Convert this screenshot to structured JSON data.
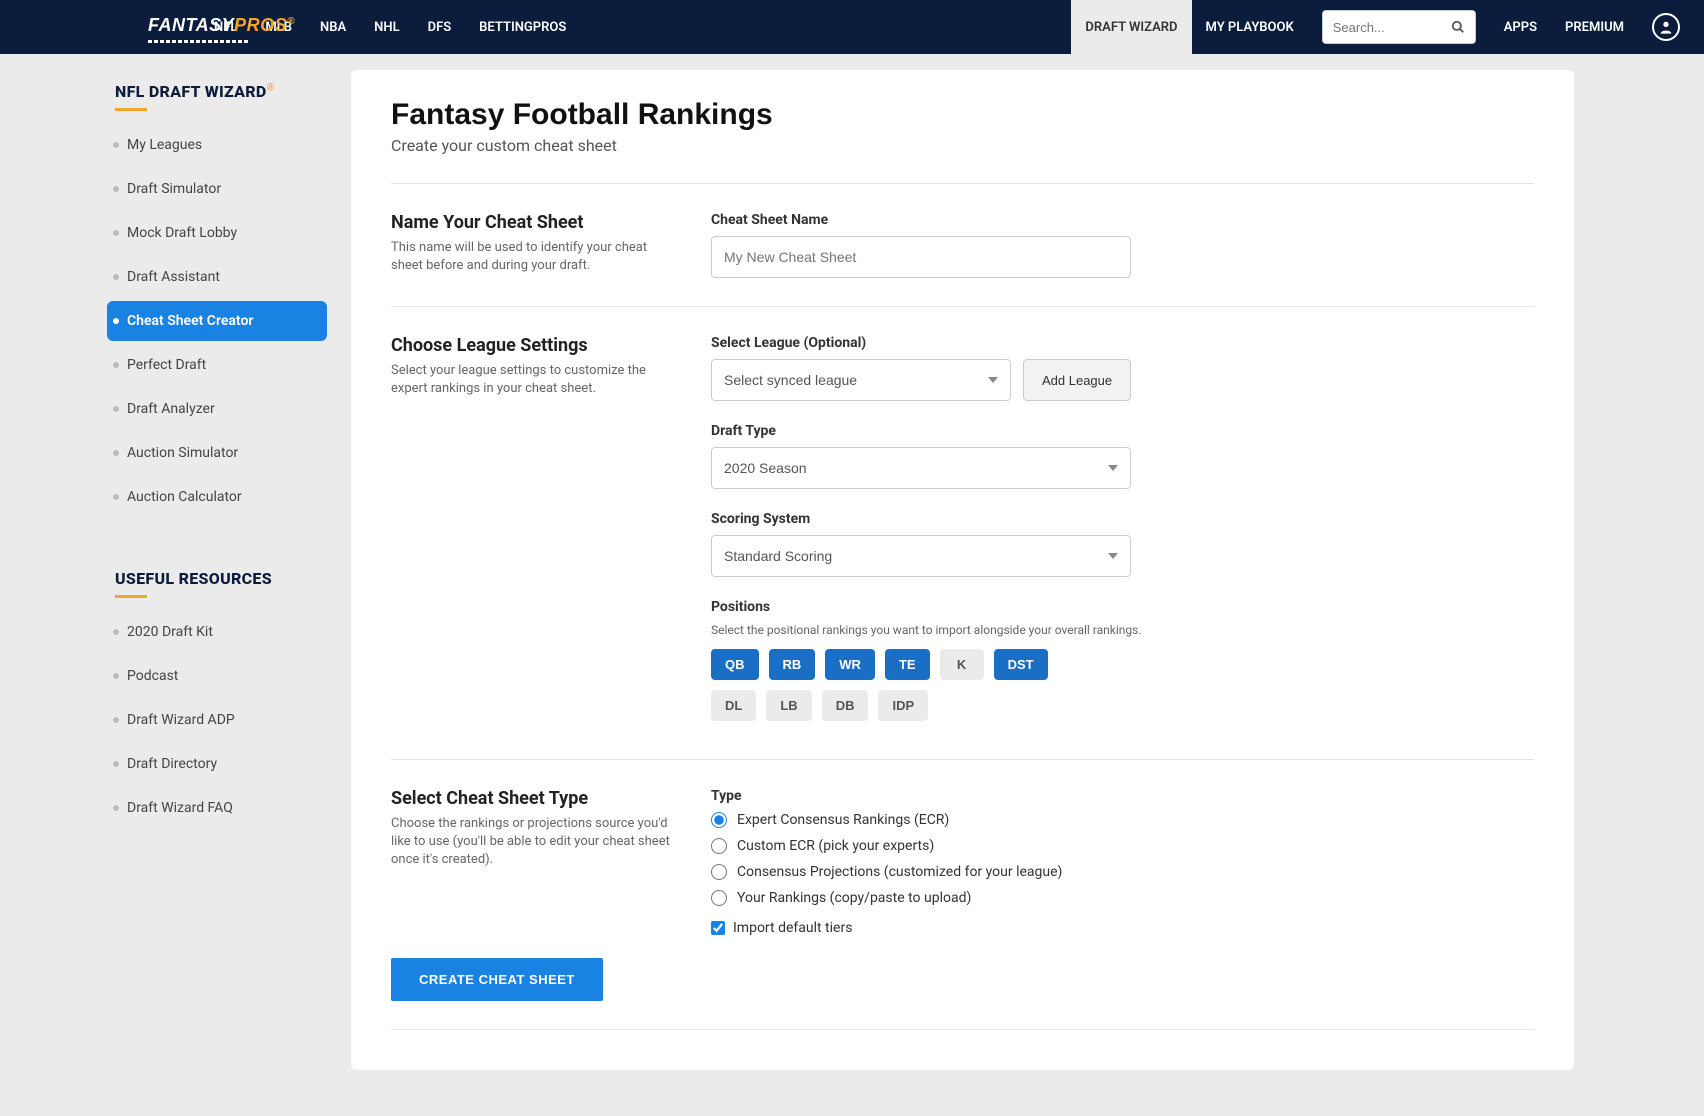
{
  "topnav": {
    "logo_a": "FANTASY",
    "logo_b": "PROS",
    "left": [
      "NFL",
      "MLB",
      "NBA",
      "NHL",
      "DFS",
      "BETTINGPROS"
    ],
    "right": [
      {
        "label": "DRAFT WIZARD",
        "active": true
      },
      {
        "label": "MY PLAYBOOK",
        "active": false
      }
    ],
    "search_placeholder": "Search...",
    "after_search": [
      "APPS",
      "PREMIUM"
    ]
  },
  "sidebar": {
    "title": "NFL DRAFT WIZARD",
    "items": [
      {
        "label": "My Leagues",
        "active": false
      },
      {
        "label": "Draft Simulator",
        "active": false
      },
      {
        "label": "Mock Draft Lobby",
        "active": false
      },
      {
        "label": "Draft Assistant",
        "active": false
      },
      {
        "label": "Cheat Sheet Creator",
        "active": true
      },
      {
        "label": "Perfect Draft",
        "active": false
      },
      {
        "label": "Draft Analyzer",
        "active": false
      },
      {
        "label": "Auction Simulator",
        "active": false
      },
      {
        "label": "Auction Calculator",
        "active": false
      }
    ],
    "resources_title": "USEFUL RESOURCES",
    "resources": [
      {
        "label": "2020 Draft Kit"
      },
      {
        "label": "Podcast"
      },
      {
        "label": "Draft Wizard ADP"
      },
      {
        "label": "Draft Directory"
      },
      {
        "label": "Draft Wizard FAQ"
      }
    ]
  },
  "page": {
    "title": "Fantasy Football Rankings",
    "subtitle": "Create your custom cheat sheet"
  },
  "name_section": {
    "title": "Name Your Cheat Sheet",
    "desc": "This name will be used to identify your cheat sheet before and during your draft.",
    "field_label": "Cheat Sheet Name",
    "placeholder": "My New Cheat Sheet"
  },
  "league_section": {
    "title": "Choose League Settings",
    "desc": "Select your league settings to customize the expert rankings in your cheat sheet.",
    "select_league_label": "Select League (Optional)",
    "select_league_value": "Select synced league",
    "add_league_btn": "Add League",
    "draft_type_label": "Draft Type",
    "draft_type_value": "2020 Season",
    "scoring_label": "Scoring System",
    "scoring_value": "Standard Scoring",
    "positions_label": "Positions",
    "positions_desc": "Select the positional rankings you want to import alongside your overall rankings.",
    "positions_row1": [
      {
        "label": "QB",
        "on": true
      },
      {
        "label": "RB",
        "on": true
      },
      {
        "label": "WR",
        "on": true
      },
      {
        "label": "TE",
        "on": true
      },
      {
        "label": "K",
        "on": false
      },
      {
        "label": "DST",
        "on": true
      }
    ],
    "positions_row2": [
      {
        "label": "DL",
        "on": false
      },
      {
        "label": "LB",
        "on": false
      },
      {
        "label": "DB",
        "on": false
      },
      {
        "label": "IDP",
        "on": false
      }
    ]
  },
  "type_section": {
    "title": "Select Cheat Sheet Type",
    "desc": "Choose the rankings or projections source you'd like to use (you'll be able to edit your cheat sheet once it's created).",
    "field_label": "Type",
    "options": [
      {
        "label": "Expert Consensus Rankings (ECR)",
        "checked": true
      },
      {
        "label": "Custom ECR (pick your experts)",
        "checked": false
      },
      {
        "label": "Consensus Projections (customized for your league)",
        "checked": false
      },
      {
        "label": "Your Rankings (copy/paste to upload)",
        "checked": false
      }
    ],
    "import_tiers_label": "Import default tiers",
    "import_tiers_checked": true
  },
  "submit_label": "CREATE CHEAT SHEET"
}
